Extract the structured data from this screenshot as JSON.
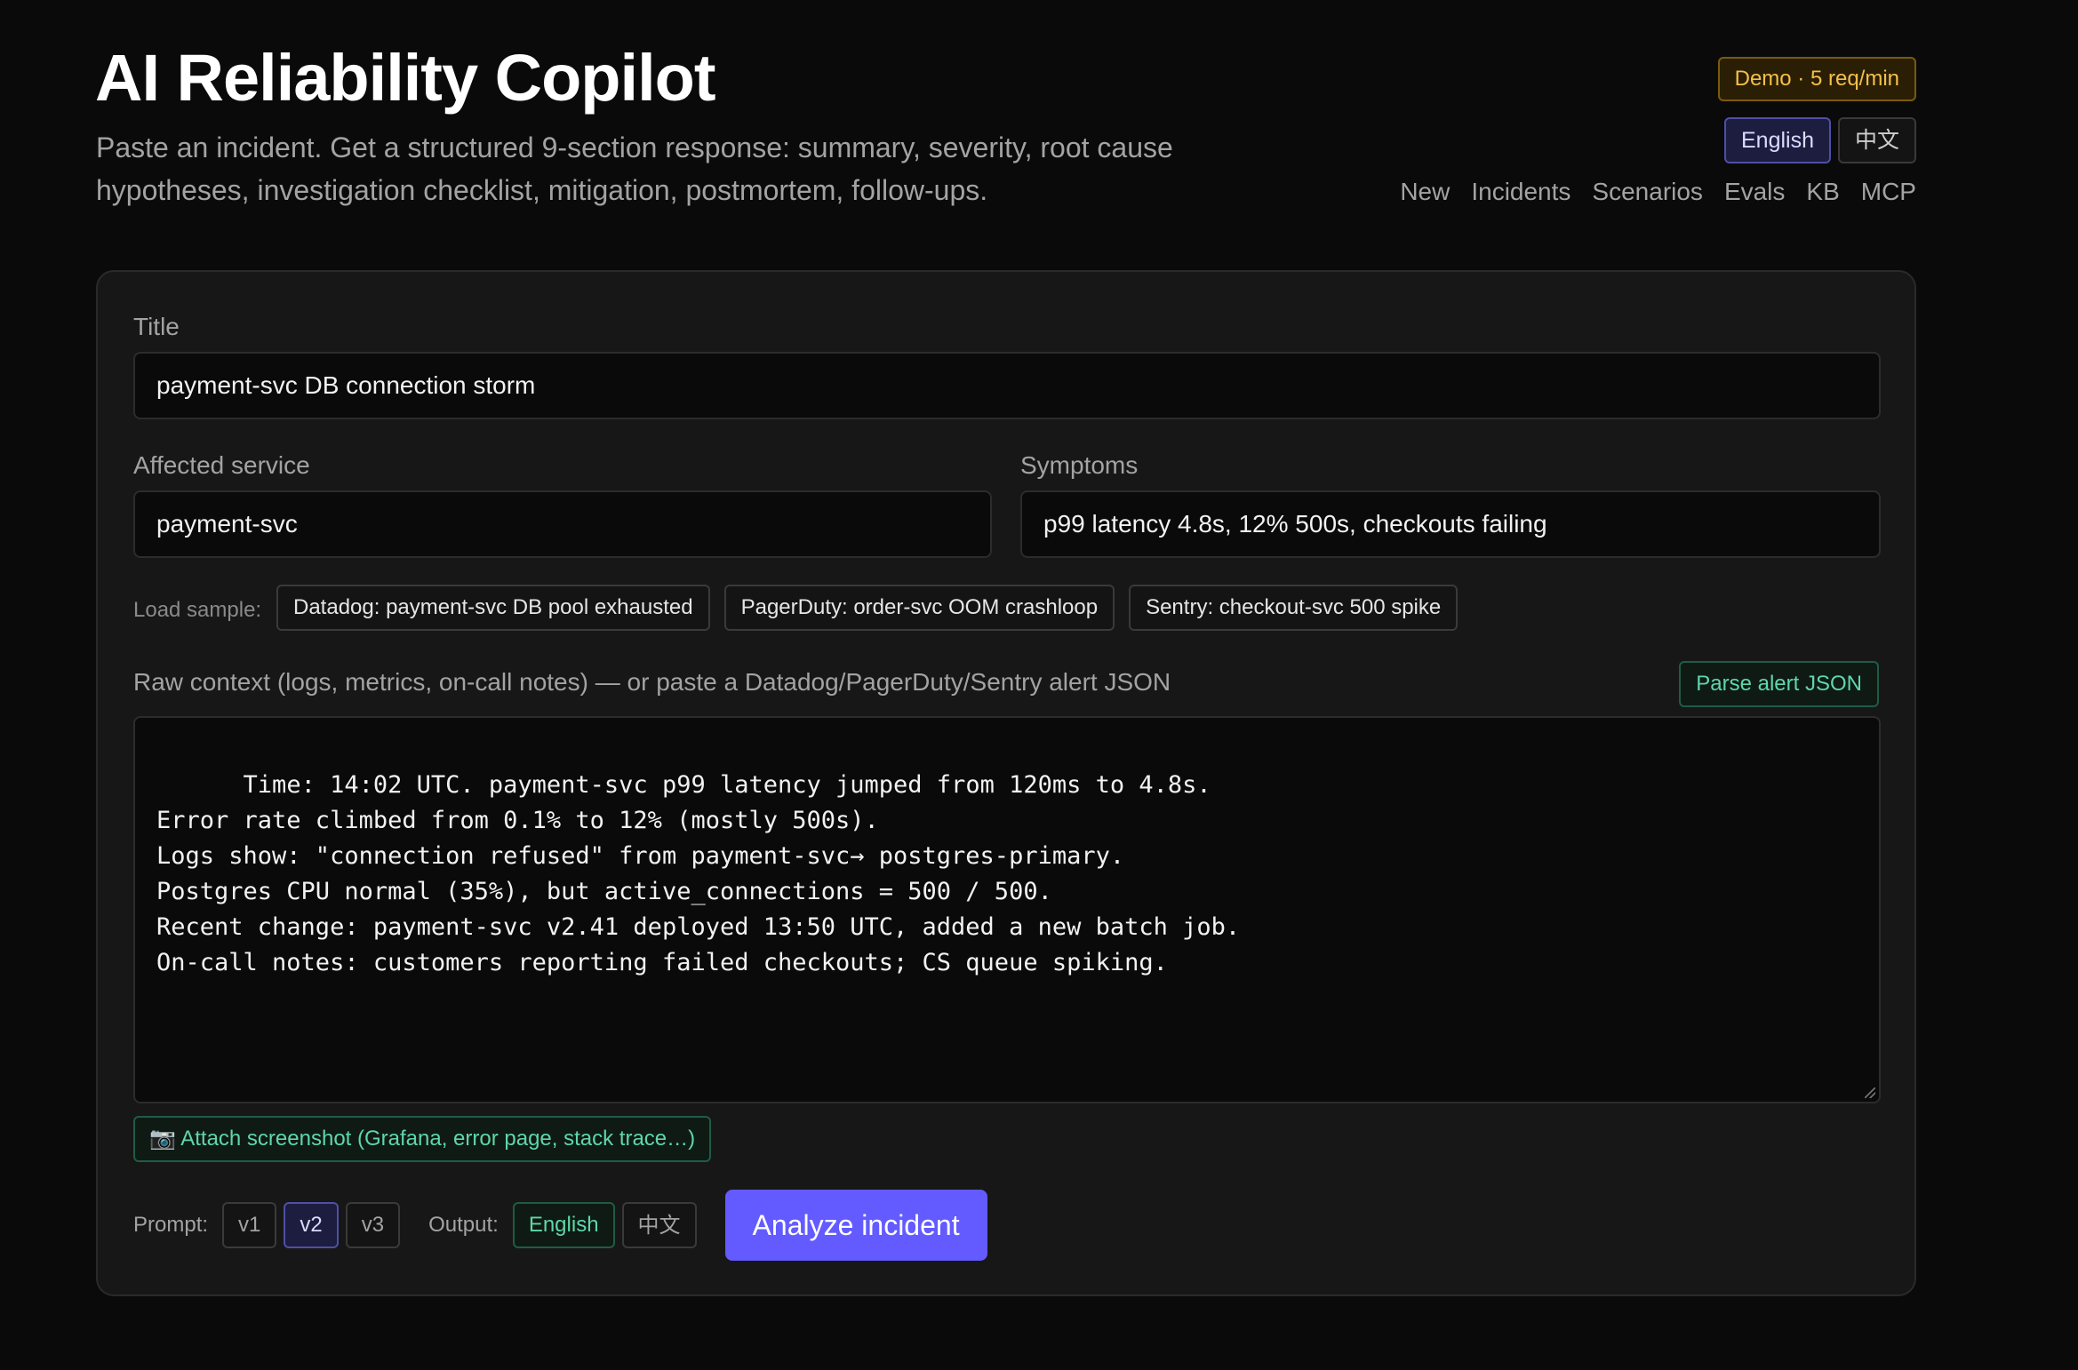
{
  "header": {
    "title": "AI Reliability Copilot",
    "subtitle": "Paste an incident. Get a structured 9-section response: summary, severity, root cause hypotheses, investigation checklist, mitigation, postmortem, follow-ups.",
    "demo_badge": "Demo · 5 req/min",
    "languages": [
      "English",
      "中文"
    ],
    "active_language": "English",
    "nav": [
      "New",
      "Incidents",
      "Scenarios",
      "Evals",
      "KB",
      "MCP"
    ]
  },
  "form": {
    "title_label": "Title",
    "title_value": "payment-svc DB connection storm",
    "affected_service_label": "Affected service",
    "affected_service_value": "payment-svc",
    "symptoms_label": "Symptoms",
    "symptoms_value": "p99 latency 4.8s, 12% 500s, checkouts failing",
    "load_sample_label": "Load sample:",
    "samples": [
      "Datadog: payment-svc DB pool exhausted",
      "PagerDuty: order-svc OOM crashloop",
      "Sentry: checkout-svc 500 spike"
    ],
    "raw_context_label": "Raw context (logs, metrics, on-call notes) — or paste a Datadog/PagerDuty/Sentry alert JSON",
    "parse_button": "Parse alert JSON",
    "raw_context_value": "Time: 14:02 UTC. payment-svc p99 latency jumped from 120ms to 4.8s.\nError rate climbed from 0.1% to 12% (mostly 500s).\nLogs show: \"connection refused\" from payment-svc→ postgres-primary.\nPostgres CPU normal (35%), but active_connections = 500 / 500.\nRecent change: payment-svc v2.41 deployed 13:50 UTC, added a new batch job.\nOn-call notes: customers reporting failed checkouts; CS queue spiking.",
    "attach_button": "📷 Attach screenshot (Grafana, error page, stack trace…)",
    "prompt_label": "Prompt:",
    "prompt_versions": [
      "v1",
      "v2",
      "v3"
    ],
    "active_prompt": "v2",
    "output_label": "Output:",
    "output_languages": [
      "English",
      "中文"
    ],
    "active_output": "English",
    "analyze_button": "Analyze incident"
  }
}
